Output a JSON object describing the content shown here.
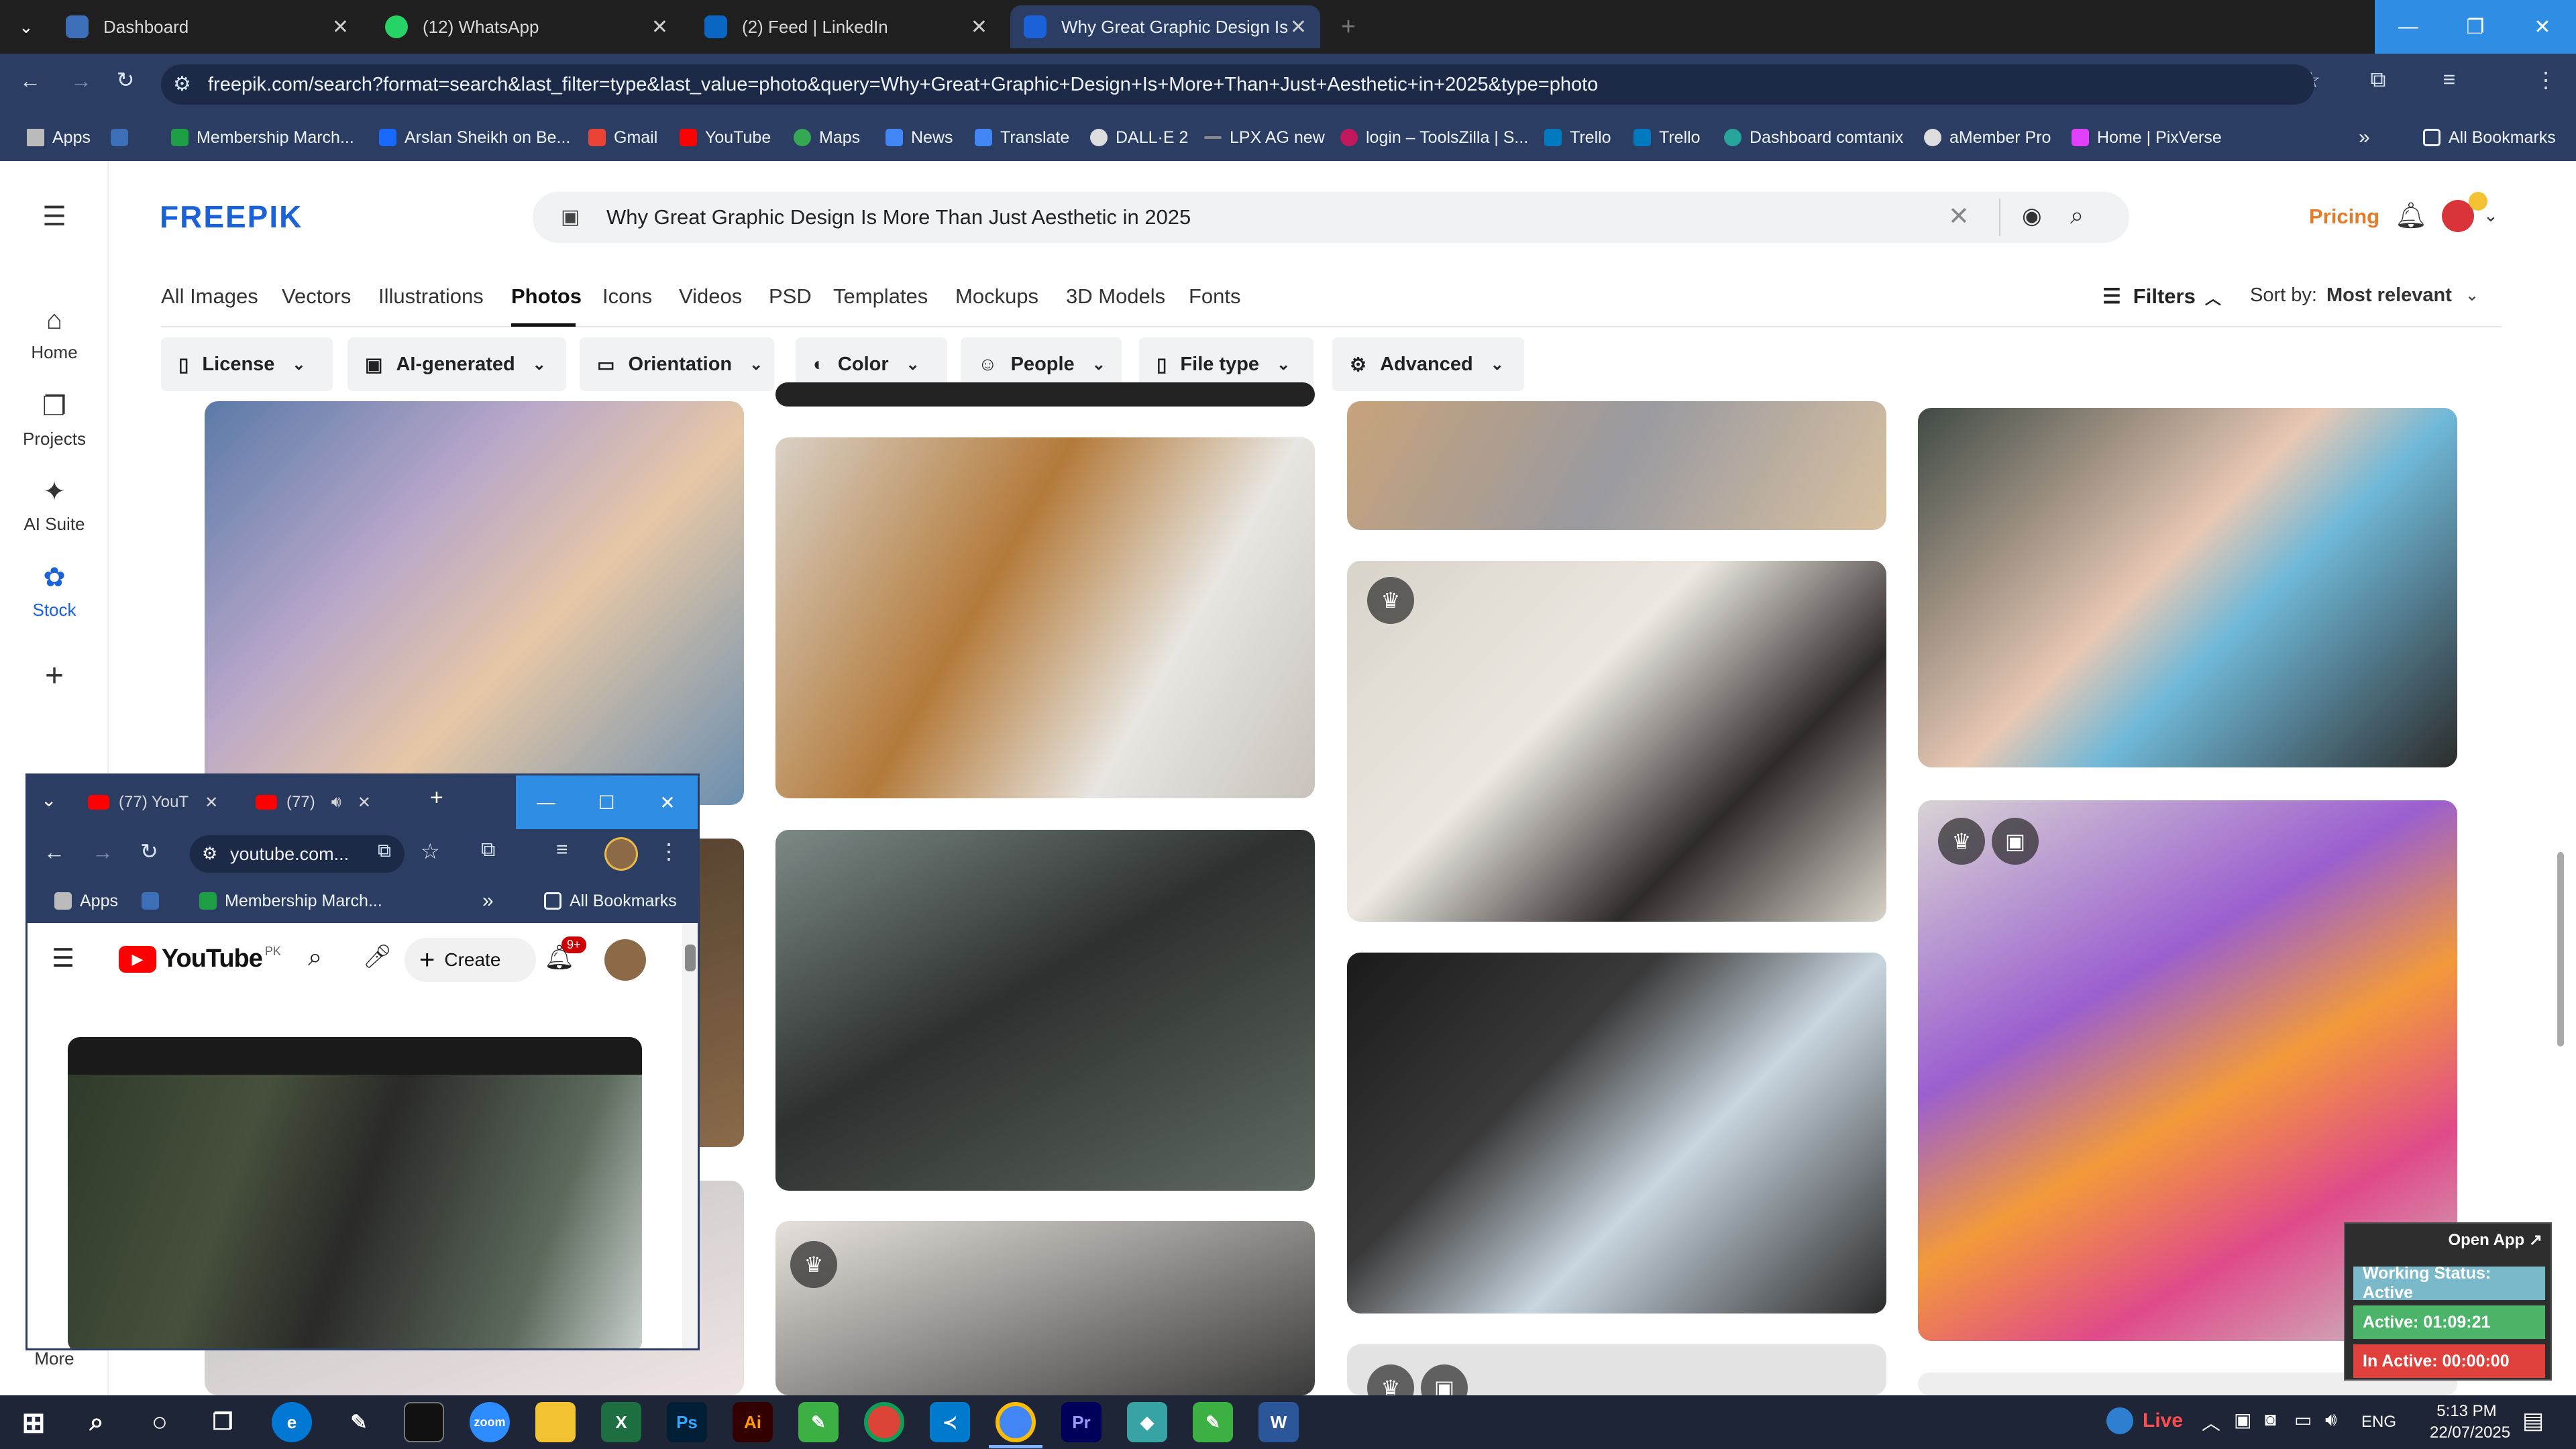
{
  "browser": {
    "tabs": [
      {
        "label": "Dashboard",
        "color": "#3d6fb8"
      },
      {
        "label": "(12) WhatsApp",
        "color": "#25d366"
      },
      {
        "label": "(2) Feed | LinkedIn",
        "color": "#0a66c2"
      },
      {
        "label": "Why Great Graphic Design Is M",
        "color": "#1b62d8"
      }
    ],
    "url": "freepik.com/search?format=search&last_filter=type&last_value=photo&query=Why+Great+Graphic+Design+Is+More+Than+Just+Aesthetic+in+2025&type=photo",
    "bookmarks": [
      {
        "label": "Apps",
        "color": "#cccccc"
      },
      {
        "label": "Membership March...",
        "color": "#1e9e45"
      },
      {
        "label": "Arslan Sheikh on Be...",
        "color": "#1769ff"
      },
      {
        "label": "Gmail",
        "color": "#ea4335"
      },
      {
        "label": "YouTube",
        "color": "#ff0000"
      },
      {
        "label": "Maps",
        "color": "#34a853"
      },
      {
        "label": "News",
        "color": "#4285f4"
      },
      {
        "label": "Translate",
        "color": "#4285f4"
      },
      {
        "label": "DALL·E 2",
        "color": "#dddddd"
      },
      {
        "label": "LPX AG new",
        "color": "#888888"
      },
      {
        "label": "login – ToolsZilla | S...",
        "color": "#c2185b"
      },
      {
        "label": "Trello",
        "color": "#0079bf"
      },
      {
        "label": "Trello",
        "color": "#0079bf"
      },
      {
        "label": "Dashboard comtanix",
        "color": "#26a69a"
      },
      {
        "label": "aMember Pro",
        "color": "#dddddd"
      },
      {
        "label": "Home | PixVerse",
        "color": "#e040fb"
      }
    ],
    "all_bookmarks": "All Bookmarks"
  },
  "freepik": {
    "logo": "FREEPIK",
    "search_value": "Why Great Graphic Design Is More Than Just Aesthetic in 2025",
    "pricing": "Pricing",
    "nav": [
      {
        "label": "Home",
        "icon": "⌂"
      },
      {
        "label": "Projects",
        "icon": "❐"
      },
      {
        "label": "AI Suite",
        "icon": "✦"
      },
      {
        "label": "Stock",
        "icon": "✿"
      }
    ],
    "more": "More",
    "categories": [
      "All Images",
      "Vectors",
      "Illustrations",
      "Photos",
      "Icons",
      "Videos",
      "PSD",
      "Templates",
      "Mockups",
      "3D Models",
      "Fonts"
    ],
    "filters_label": "Filters",
    "sort_label": "Sort by:",
    "sort_value": "Most relevant",
    "filters": [
      "License",
      "AI-generated",
      "Orientation",
      "Color",
      "People",
      "File type",
      "Advanced"
    ]
  },
  "youtube_window": {
    "tabs": [
      "(77) YouT",
      "(77)"
    ],
    "url": "youtube.com...",
    "bookmarks": [
      "Apps",
      "Membership March...",
      "All Bookmarks"
    ],
    "create": "Create",
    "notif": "9+",
    "region": "PK",
    "logo": "YouTube"
  },
  "status_widget": {
    "open_app": "Open App ↗",
    "working": "Working Status: Active",
    "active": "Active: 01:09:21",
    "inactive": "In Active: 00:00:00"
  },
  "taskbar": {
    "live": "Live",
    "lang": "ENG",
    "time": "5:13 PM",
    "date": "22/07/2025"
  }
}
